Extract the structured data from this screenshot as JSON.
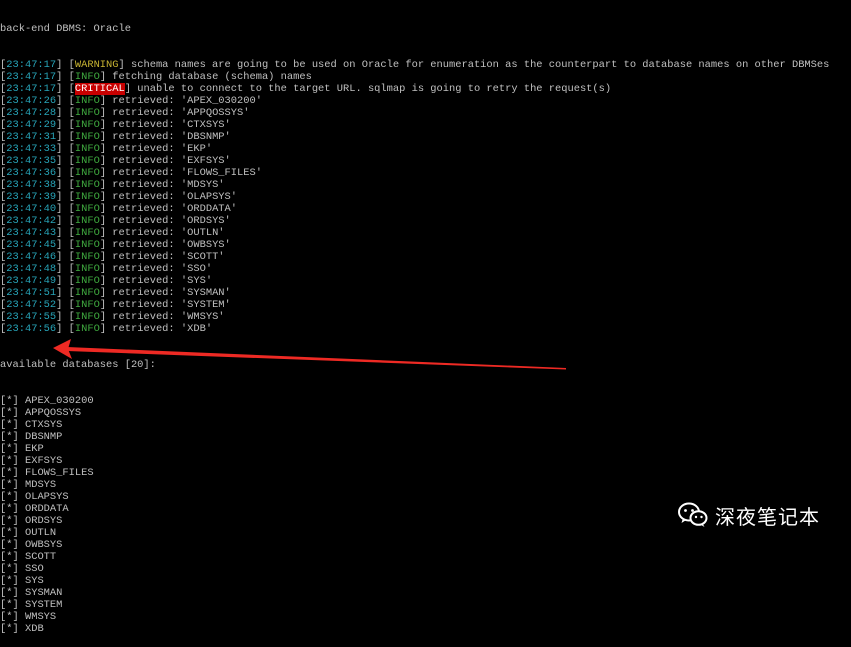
{
  "terminal": {
    "header_line": "back-end DBMS: Oracle",
    "log_lines": [
      {
        "time": "23:47:17",
        "level": "WARNING",
        "message": "schema names are going to be used on Oracle for enumeration as the counterpart to database names on other DBMSes"
      },
      {
        "time": "23:47:17",
        "level": "INFO",
        "message": "fetching database (schema) names"
      },
      {
        "time": "23:47:17",
        "level": "CRITICAL",
        "message": "unable to connect to the target URL. sqlmap is going to retry the request(s)"
      },
      {
        "time": "23:47:26",
        "level": "INFO",
        "message": "retrieved: 'APEX_030200'"
      },
      {
        "time": "23:47:28",
        "level": "INFO",
        "message": "retrieved: 'APPQOSSYS'"
      },
      {
        "time": "23:47:29",
        "level": "INFO",
        "message": "retrieved: 'CTXSYS'"
      },
      {
        "time": "23:47:31",
        "level": "INFO",
        "message": "retrieved: 'DBSNMP'"
      },
      {
        "time": "23:47:33",
        "level": "INFO",
        "message": "retrieved: 'EKP'"
      },
      {
        "time": "23:47:35",
        "level": "INFO",
        "message": "retrieved: 'EXFSYS'"
      },
      {
        "time": "23:47:36",
        "level": "INFO",
        "message": "retrieved: 'FLOWS_FILES'"
      },
      {
        "time": "23:47:38",
        "level": "INFO",
        "message": "retrieved: 'MDSYS'"
      },
      {
        "time": "23:47:39",
        "level": "INFO",
        "message": "retrieved: 'OLAPSYS'"
      },
      {
        "time": "23:47:40",
        "level": "INFO",
        "message": "retrieved: 'ORDDATA'"
      },
      {
        "time": "23:47:42",
        "level": "INFO",
        "message": "retrieved: 'ORDSYS'"
      },
      {
        "time": "23:47:43",
        "level": "INFO",
        "message": "retrieved: 'OUTLN'"
      },
      {
        "time": "23:47:45",
        "level": "INFO",
        "message": "retrieved: 'OWBSYS'"
      },
      {
        "time": "23:47:46",
        "level": "INFO",
        "message": "retrieved: 'SCOTT'"
      },
      {
        "time": "23:47:48",
        "level": "INFO",
        "message": "retrieved: 'SSO'"
      },
      {
        "time": "23:47:49",
        "level": "INFO",
        "message": "retrieved: 'SYS'"
      },
      {
        "time": "23:47:51",
        "level": "INFO",
        "message": "retrieved: 'SYSMAN'"
      },
      {
        "time": "23:47:52",
        "level": "INFO",
        "message": "retrieved: 'SYSTEM'"
      },
      {
        "time": "23:47:55",
        "level": "INFO",
        "message": "retrieved: 'WMSYS'"
      },
      {
        "time": "23:47:56",
        "level": "INFO",
        "message": "retrieved: 'XDB'"
      }
    ],
    "available_header": "available databases [20]:",
    "db_marker": "[*]",
    "databases": [
      "APEX_030200",
      "APPQOSSYS",
      "CTXSYS",
      "DBSNMP",
      "EKP",
      "EXFSYS",
      "FLOWS_FILES",
      "MDSYS",
      "OLAPSYS",
      "ORDDATA",
      "ORDSYS",
      "OUTLN",
      "OWBSYS",
      "SCOTT",
      "SSO",
      "SYS",
      "SYSMAN",
      "SYSTEM",
      "WMSYS",
      "XDB"
    ],
    "highlighted_database": "EKP"
  },
  "annotation": {
    "arrow_color": "#ee2a24",
    "points_to": "EKP"
  },
  "watermark": {
    "icon": "wechat-icon",
    "text": "深夜笔记本"
  },
  "colors": {
    "background": "#000000",
    "text": "#c0c0c0",
    "timestamp": "#27a4b8",
    "info": "#3faa3f",
    "warning": "#c8b432",
    "critical_bg": "#c80000"
  }
}
